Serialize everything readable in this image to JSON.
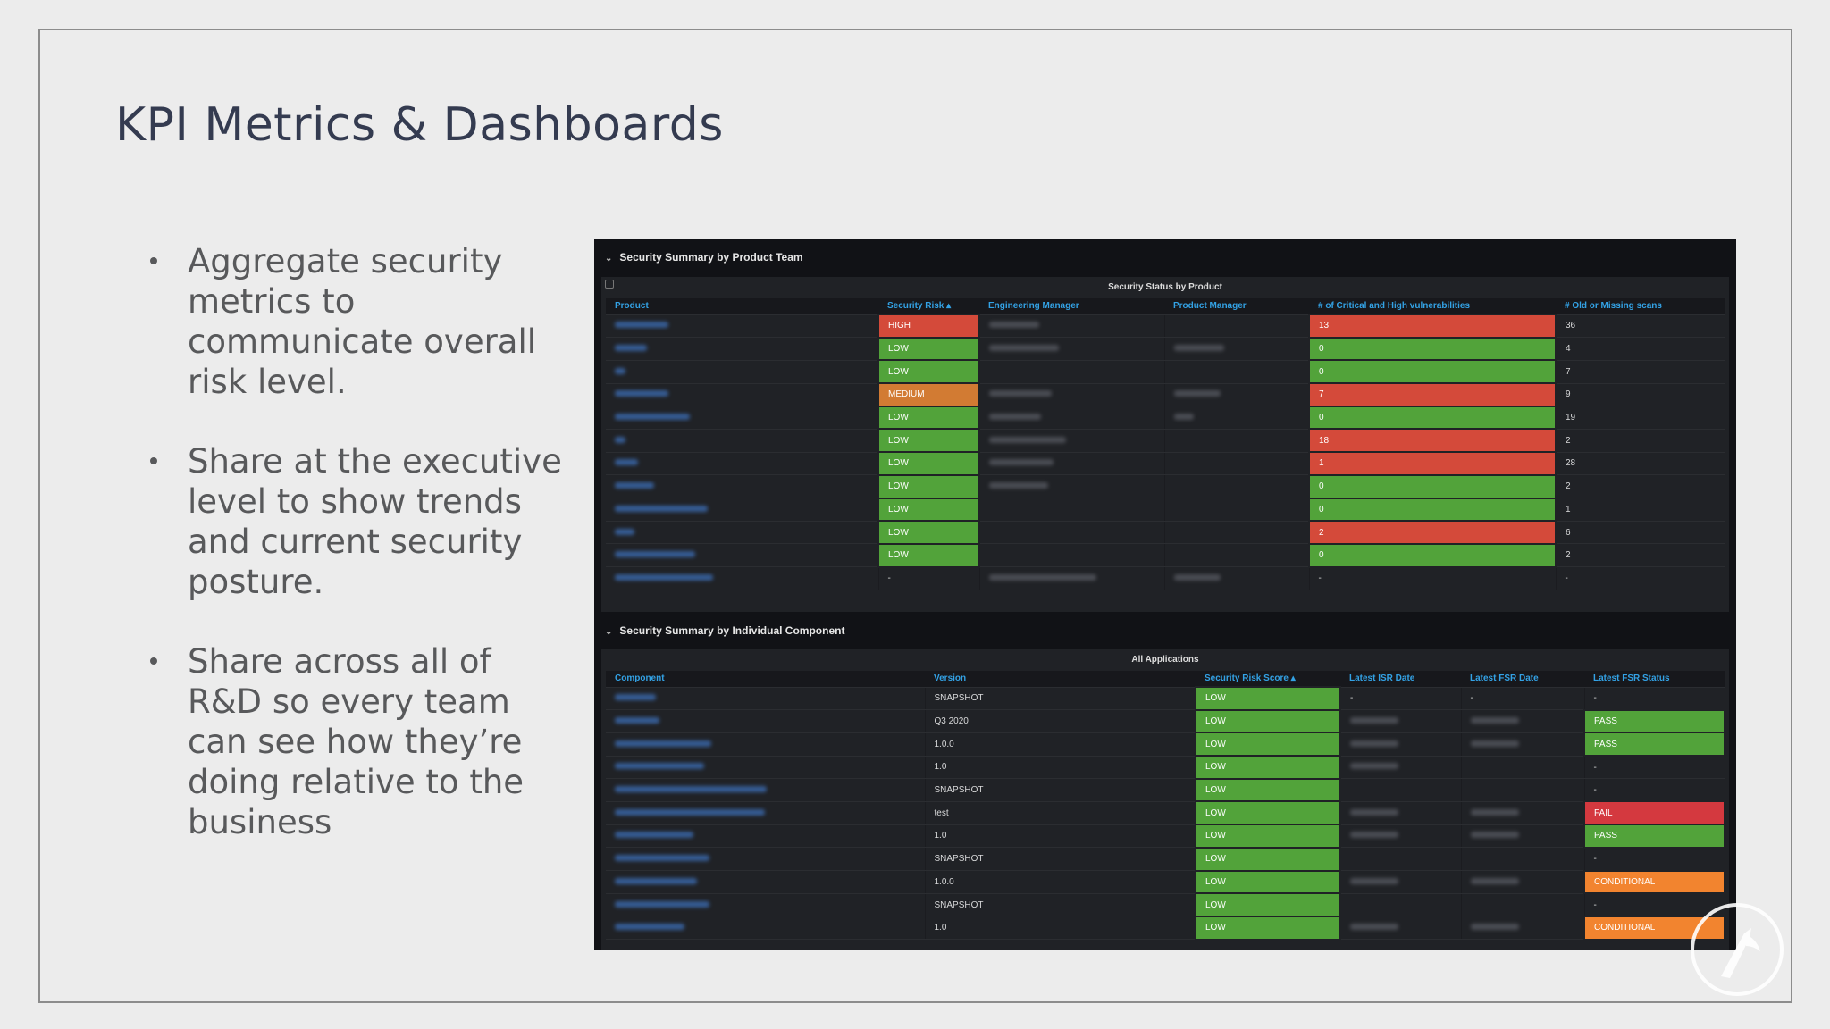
{
  "slide": {
    "title": "KPI Metrics & Dashboards",
    "bullets": [
      "Aggregate security metrics to communicate overall risk level.",
      "Share at the executive level to show trends and current security posture.",
      "Share across all of R&D so every team can see how they’re doing relative to the business"
    ]
  },
  "dashboard": {
    "section1": {
      "header": "Security Summary by Product Team",
      "panel_title": "Security Status by Product",
      "columns": [
        "Product",
        "Security Risk ▴",
        "Engineering Manager",
        "Product Manager",
        "# of Critical and High vulnerabilities",
        "# Old or Missing scans"
      ],
      "rows": [
        {
          "risk": "HIGH",
          "vulns": "13",
          "scans": "36"
        },
        {
          "risk": "LOW",
          "vulns": "0",
          "scans": "4"
        },
        {
          "risk": "LOW",
          "vulns": "0",
          "scans": "7"
        },
        {
          "risk": "MEDIUM",
          "vulns": "7",
          "scans": "9"
        },
        {
          "risk": "LOW",
          "vulns": "0",
          "scans": "19"
        },
        {
          "risk": "LOW",
          "vulns": "18",
          "scans": "2"
        },
        {
          "risk": "LOW",
          "vulns": "1",
          "scans": "28"
        },
        {
          "risk": "LOW",
          "vulns": "0",
          "scans": "2"
        },
        {
          "risk": "LOW",
          "vulns": "0",
          "scans": "1"
        },
        {
          "risk": "LOW",
          "vulns": "2",
          "scans": "6"
        },
        {
          "risk": "LOW",
          "vulns": "0",
          "scans": "2"
        },
        {
          "risk": "-",
          "vulns": "-",
          "scans": "-"
        }
      ]
    },
    "section2": {
      "header": "Security Summary by Individual Component",
      "panel_title": "All Applications",
      "columns": [
        "Component",
        "Version",
        "Security Risk Score ▴",
        "Latest ISR Date",
        "Latest FSR Date",
        "Latest FSR Status"
      ],
      "rows": [
        {
          "version": "SNAPSHOT",
          "score": "LOW",
          "isr": "-",
          "fsr": "-",
          "status": "-"
        },
        {
          "version": "Q3 2020",
          "score": "LOW",
          "status": "PASS"
        },
        {
          "version": "1.0.0",
          "score": "LOW",
          "status": "PASS"
        },
        {
          "version": "1.0",
          "score": "LOW",
          "status": "-"
        },
        {
          "version": "SNAPSHOT",
          "score": "LOW",
          "status": "-"
        },
        {
          "version": "test",
          "score": "LOW",
          "status": "FAIL"
        },
        {
          "version": "1.0",
          "score": "LOW",
          "status": "PASS"
        },
        {
          "version": "SNAPSHOT",
          "score": "LOW",
          "status": "-"
        },
        {
          "version": "1.0.0",
          "score": "LOW",
          "status": "CONDITIONAL"
        },
        {
          "version": "SNAPSHOT",
          "score": "LOW",
          "status": "-"
        },
        {
          "version": "1.0",
          "score": "LOW",
          "status": "CONDITIONAL"
        }
      ]
    }
  }
}
